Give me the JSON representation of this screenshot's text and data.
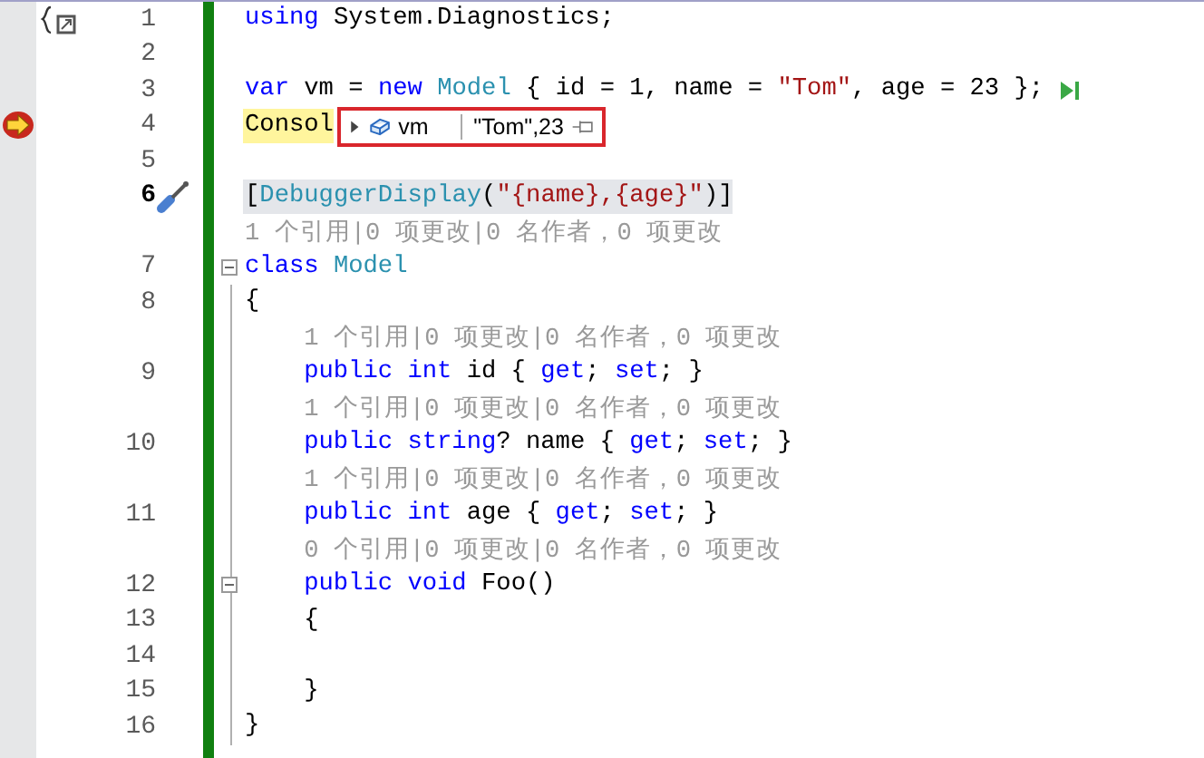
{
  "lines": [
    {
      "kind": "code",
      "number": "1",
      "current": false,
      "collapsible": false,
      "indented": false,
      "scope_icon": true,
      "tokens": [
        {
          "t": "using ",
          "kind": "keyword"
        },
        {
          "t": "System.Diagnostics;",
          "kind": "plain"
        }
      ]
    },
    {
      "kind": "code",
      "number": "2",
      "current": false,
      "collapsible": false
    },
    {
      "kind": "code",
      "number": "3",
      "current": false,
      "collapsible": false,
      "indented": false,
      "run_to_click": true,
      "tokens": [
        {
          "t": "var",
          "kind": "keyword"
        },
        {
          "t": " vm = ",
          "kind": "plain"
        },
        {
          "t": "new ",
          "kind": "keyword"
        },
        {
          "t": "Model",
          "kind": "type"
        },
        {
          "t": " { id = 1, name = ",
          "kind": "plain"
        },
        {
          "t": "\"Tom\"",
          "kind": "string"
        },
        {
          "t": ", age = 23 };",
          "kind": "plain"
        }
      ]
    },
    {
      "kind": "code",
      "number": "4",
      "current": false,
      "collapsible": false,
      "indented": false,
      "current_statement": true,
      "tokens": [
        {
          "t": "Consol",
          "kind": "plain"
        }
      ],
      "datatip": {
        "name": "vm",
        "value": "\"Tom\",23",
        "expanded": false
      }
    },
    {
      "kind": "code",
      "number": "5",
      "current": false,
      "collapsible": false
    },
    {
      "kind": "code",
      "number": "6",
      "current": true,
      "collapsible": false,
      "indented": false,
      "selected": true,
      "quick_actions": true,
      "tokens": [
        {
          "t": "[",
          "kind": "plain"
        },
        {
          "t": "DebuggerDisplay",
          "kind": "type"
        },
        {
          "t": "(",
          "kind": "plain"
        },
        {
          "t": "\"{name},{age}\"",
          "kind": "string"
        },
        {
          "t": ")]",
          "kind": "plain"
        }
      ]
    },
    {
      "kind": "lens",
      "indented": false,
      "text": "1 个引用|0 项更改|0 名作者，0 项更改"
    },
    {
      "kind": "code",
      "number": "7",
      "current": false,
      "collapsible": true,
      "indented": false,
      "tokens": [
        {
          "t": "class ",
          "kind": "keyword"
        },
        {
          "t": "Model",
          "kind": "type"
        }
      ]
    },
    {
      "kind": "code",
      "number": "8",
      "current": false,
      "collapsible": false,
      "indented": false,
      "tokens": [
        {
          "t": "{",
          "kind": "plain"
        }
      ]
    },
    {
      "kind": "lens",
      "indented": true,
      "text": "1 个引用|0 项更改|0 名作者，0 项更改"
    },
    {
      "kind": "code",
      "number": "9",
      "current": false,
      "collapsible": false,
      "indented": true,
      "tokens": [
        {
          "t": "public int ",
          "kind": "keyword"
        },
        {
          "t": "id { ",
          "kind": "plain"
        },
        {
          "t": "get",
          "kind": "keyword"
        },
        {
          "t": "; ",
          "kind": "plain"
        },
        {
          "t": "set",
          "kind": "keyword"
        },
        {
          "t": "; }",
          "kind": "plain"
        }
      ]
    },
    {
      "kind": "lens",
      "indented": true,
      "text": "1 个引用|0 项更改|0 名作者，0 项更改"
    },
    {
      "kind": "code",
      "number": "10",
      "current": false,
      "collapsible": false,
      "indented": true,
      "tokens": [
        {
          "t": "public string",
          "kind": "keyword"
        },
        {
          "t": "? name { ",
          "kind": "plain"
        },
        {
          "t": "get",
          "kind": "keyword"
        },
        {
          "t": "; ",
          "kind": "plain"
        },
        {
          "t": "set",
          "kind": "keyword"
        },
        {
          "t": "; }",
          "kind": "plain"
        }
      ]
    },
    {
      "kind": "lens",
      "indented": true,
      "text": "1 个引用|0 项更改|0 名作者，0 项更改"
    },
    {
      "kind": "code",
      "number": "11",
      "current": false,
      "collapsible": false,
      "indented": true,
      "tokens": [
        {
          "t": "public int ",
          "kind": "keyword"
        },
        {
          "t": "age { ",
          "kind": "plain"
        },
        {
          "t": "get",
          "kind": "keyword"
        },
        {
          "t": "; ",
          "kind": "plain"
        },
        {
          "t": "set",
          "kind": "keyword"
        },
        {
          "t": "; }",
          "kind": "plain"
        }
      ]
    },
    {
      "kind": "lens",
      "indented": true,
      "text": "0 个引用|0 项更改|0 名作者，0 项更改"
    },
    {
      "kind": "code",
      "number": "12",
      "current": false,
      "collapsible": true,
      "indented": true,
      "tokens": [
        {
          "t": "public void ",
          "kind": "keyword"
        },
        {
          "t": "Foo()",
          "kind": "plain"
        }
      ]
    },
    {
      "kind": "code",
      "number": "13",
      "current": false,
      "collapsible": false,
      "indented": true,
      "tokens": [
        {
          "t": "{",
          "kind": "plain"
        }
      ]
    },
    {
      "kind": "code",
      "number": "14",
      "current": false,
      "collapsible": false
    },
    {
      "kind": "code",
      "number": "15",
      "current": false,
      "collapsible": false,
      "indented": true,
      "tokens": [
        {
          "t": "}",
          "kind": "plain"
        }
      ]
    },
    {
      "kind": "code",
      "number": "16",
      "current": false,
      "collapsible": false,
      "indented": false,
      "tokens": [
        {
          "t": "}",
          "kind": "plain"
        }
      ]
    }
  ]
}
